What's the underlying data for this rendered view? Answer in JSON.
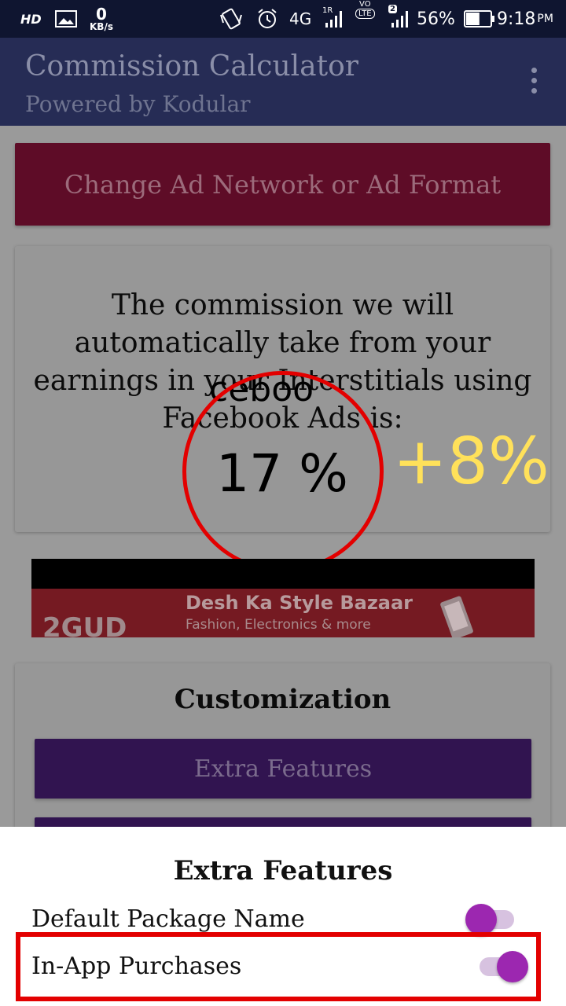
{
  "status_bar": {
    "hd": "HD",
    "speed_value": "0",
    "speed_unit": "KB/s",
    "network": "4G",
    "roaming": "1R",
    "volte_top": "VO",
    "volte_bottom": "LTE",
    "sim_badge": "2",
    "battery_percent": "56%",
    "battery_level": 0.56,
    "time": "9:18",
    "ampm": "PM"
  },
  "app_bar": {
    "title": "Commission Calculator",
    "subtitle": "Powered by Kodular"
  },
  "ad_button": {
    "label": "Change Ad Network or Ad Format"
  },
  "commission_card": {
    "text": "The commission we will automatically take from your earnings in your Interstitials using Facebook Ads is:",
    "overlay_text": "ceboo",
    "percent": "17 %",
    "annotation": "+8%"
  },
  "banner_ad": {
    "logo": "2GUD",
    "headline": "Desh Ka Style Bazaar",
    "subline": "Fashion, Electronics & more"
  },
  "customization": {
    "title": "Customization",
    "extra_features_button": "Extra Features",
    "second_button": ""
  },
  "extra_features_sheet": {
    "title": "Extra Features",
    "rows": [
      {
        "label": "Default Package Name",
        "enabled": false
      },
      {
        "label": "In-App Purchases",
        "enabled": true
      }
    ]
  },
  "colors": {
    "status_bar": "#0f1530",
    "app_bar": "#262c55",
    "ad_button": "#5e0c27",
    "purple_button": "#311450",
    "toggle_thumb": "#9c27b0",
    "annotation_red": "#e30000",
    "annotation_yellow": "#ffe15a"
  }
}
